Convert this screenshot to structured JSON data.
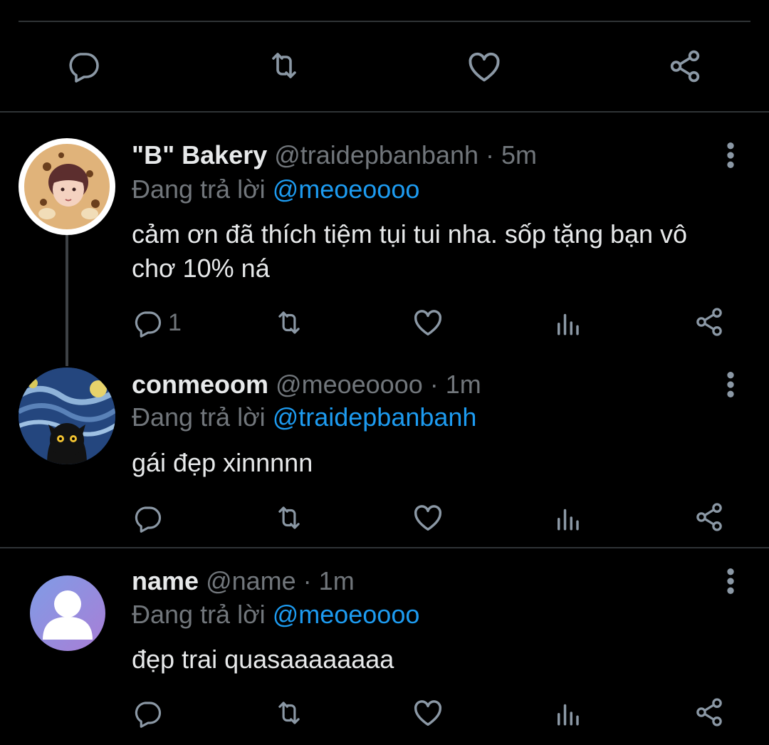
{
  "top_actions": [
    "reply-icon",
    "retweet-icon",
    "like-icon",
    "share-icon"
  ],
  "colors": {
    "background": "#000000",
    "text": "#e7e9ea",
    "muted": "#71767b",
    "link": "#1d9bf0",
    "divider": "#2f3336"
  },
  "tweets": [
    {
      "display_name": "\"B\" Bakery",
      "handle": "@traidepbanbanh",
      "time_sep": " · ",
      "time": "5m",
      "reply_prefix": "Đang trả lời ",
      "reply_to": "@meoeoooo",
      "text": "cảm ơn đã thích tiệm tụi tui nha. sốp tặng bạn vô chơ 10% ná",
      "reply_count": "1"
    },
    {
      "display_name": "conmeoom",
      "handle": "@meoeoooo",
      "time_sep": " · ",
      "time": "1m",
      "reply_prefix": "Đang trả lời ",
      "reply_to": "@traidepbanbanh",
      "text": "gái đẹp xinnnnn",
      "reply_count": ""
    },
    {
      "display_name": "name",
      "handle": "@name",
      "time_sep": " · ",
      "time": "1m",
      "reply_prefix": "Đang trả lời ",
      "reply_to": "@meoeoooo",
      "text": "đẹp trai quasaaaaaaaa",
      "reply_count": ""
    }
  ]
}
